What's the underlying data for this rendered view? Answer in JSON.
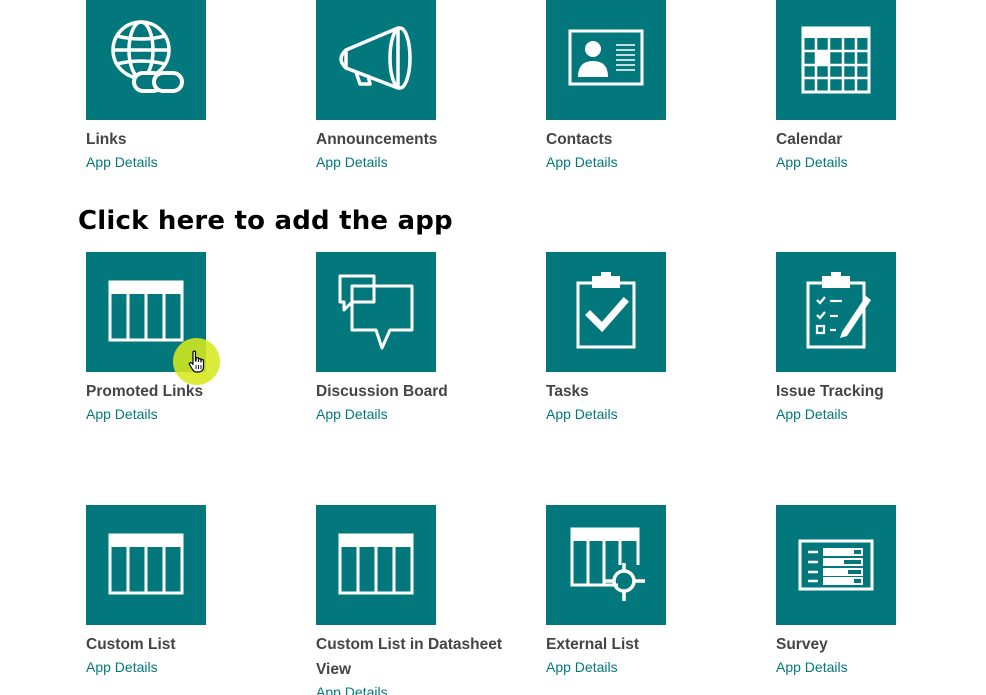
{
  "annotation": "Click here to add the app",
  "colors": {
    "tile_bg": "#03787c",
    "link": "#03787c",
    "title": "#444444",
    "cursor_highlight": "#d6e81c"
  },
  "apps": [
    {
      "title": "Links",
      "details": "App Details",
      "icon": "globe-link-icon"
    },
    {
      "title": "Announcements",
      "details": "App Details",
      "icon": "megaphone-icon"
    },
    {
      "title": "Contacts",
      "details": "App Details",
      "icon": "contact-card-icon"
    },
    {
      "title": "Calendar",
      "details": "App Details",
      "icon": "calendar-icon"
    },
    {
      "title": "Promoted Links",
      "details": "App Details",
      "icon": "list-table-icon"
    },
    {
      "title": "Discussion Board",
      "details": "App Details",
      "icon": "speech-bubbles-icon"
    },
    {
      "title": "Tasks",
      "details": "App Details",
      "icon": "clipboard-check-icon"
    },
    {
      "title": "Issue Tracking",
      "details": "App Details",
      "icon": "clipboard-checklist-pencil-icon"
    },
    {
      "title": "Custom List",
      "details": "App Details",
      "icon": "list-table-icon"
    },
    {
      "title": "Custom List in Datasheet View",
      "details": "App Details",
      "icon": "list-table-icon"
    },
    {
      "title": "External List",
      "details": "App Details",
      "icon": "external-list-icon"
    },
    {
      "title": "Survey",
      "details": "App Details",
      "icon": "survey-icon"
    }
  ]
}
